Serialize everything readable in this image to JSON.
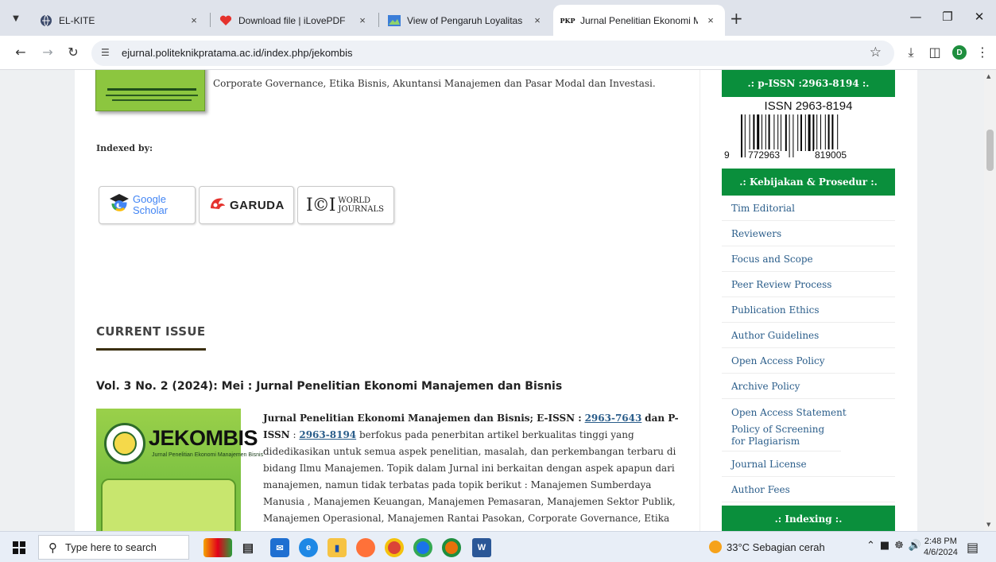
{
  "browser": {
    "tabs": [
      {
        "title": "EL-KITE",
        "active": false
      },
      {
        "title": "Download file | iLovePDF",
        "active": false
      },
      {
        "title": "View of Pengaruh Loyalitas Mer",
        "active": false
      },
      {
        "title": "Jurnal Penelitian Ekonomi Mana",
        "active": true
      }
    ],
    "url": "ejurnal.politeknikpratama.ac.id/index.php/jekombis",
    "profile_initial": "D",
    "new_tab_label": "+",
    "tab_close_label": "×"
  },
  "main": {
    "top_text": "Corporate Governance, Etika Bisnis, Akuntansi Manajemen dan Pasar Modal dan Investasi.",
    "indexed_by": "Indexed by:",
    "index_logos": {
      "google_line1": "Google",
      "google_line2": "Scholar",
      "garuda": "GARUDA",
      "ici_mark": "I©I",
      "ici_line1": "WORLD",
      "ici_line2": "JOURNALS"
    },
    "current_issue_heading": "CURRENT ISSUE",
    "issue_title": "Vol. 3 No. 2 (2024): Mei : Jurnal Penelitian Ekonomi Manajemen dan Bisnis",
    "cover": {
      "brand": "JEKOMBIS",
      "subtitle": "Jurnal Penelitian Ekonomi Manajemen Bisnis"
    },
    "description": {
      "lead": "Jurnal Penelitian Ekonomi Manajemen dan Bisnis; E-ISSN :",
      "eissn": "2963-7643",
      "mid": "dan P-ISSN",
      "colon": ":",
      "pissn": "2963-8194",
      "body": "berfokus pada penerbitan artikel berkualitas tinggi yang didedikasikan untuk semua aspek penelitian, masalah, dan perkembangan terbaru di bidang Ilmu Manajemen. Topik dalam Jurnal ini berkaitan dengan aspek apapun dari manajemen, namun tidak terbatas pada topik berikut : Manajemen Sumberdaya Manusia , Manajemen Keuangan, Manajemen Pemasaran, Manajemen Sektor Publik, Manajemen Operasional, Manajemen Rantai Pasokan, Corporate Governance, Etika"
    }
  },
  "sidebar": {
    "pissn_heading": ".: p-ISSN :2963-8194 :.",
    "barcode": {
      "issn_text": "ISSN 2963-8194",
      "num_left": "9",
      "num_mid": "772963",
      "num_right": "819005"
    },
    "policy_heading": ".: Kebijakan & Prosedur :.",
    "items": [
      "Tim Editorial",
      "Reviewers",
      "Focus and Scope",
      "Peer Review Process",
      "Publication Ethics",
      "Author Guidelines",
      "Open Access Policy",
      "Archive Policy",
      "Open Access Statement",
      "Policy of Screening for Plagiarism",
      "Journal License",
      "Author Fees"
    ],
    "indexing_heading": ".: Indexing :."
  },
  "taskbar": {
    "search_placeholder": "Type here to search",
    "weather": "33°C  Sebagian cerah",
    "time": "2:48 PM",
    "date": "4/6/2024"
  },
  "colors": {
    "sidebar_green": "#0a8f3c",
    "link_blue": "#2a5d8a",
    "cover_green": "#7dc242"
  }
}
